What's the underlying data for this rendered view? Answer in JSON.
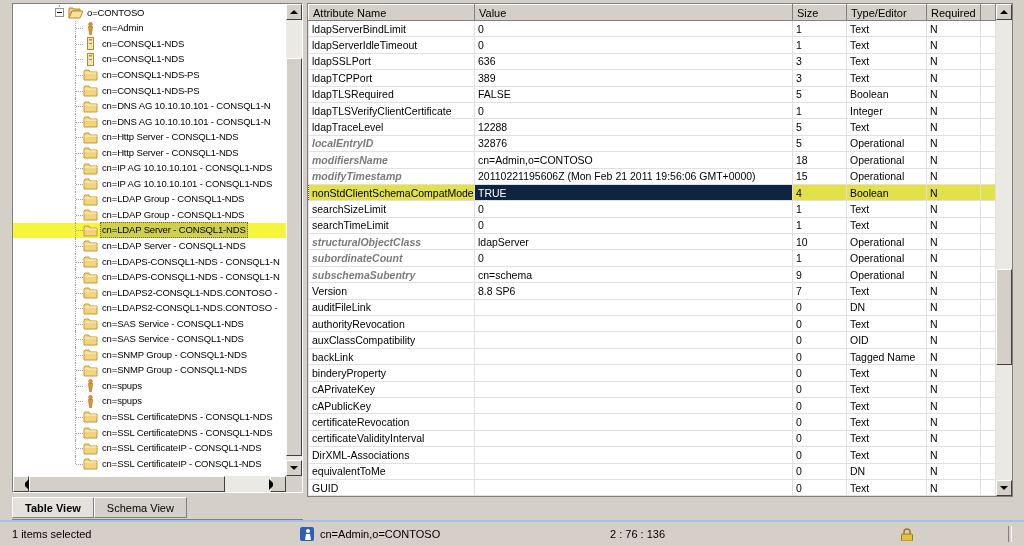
{
  "tree": {
    "root": {
      "label": "o=CONTOSO",
      "expanded": true,
      "selected": false,
      "children": [
        {
          "label": "cn=Admin",
          "kind": "user",
          "selected": false
        },
        {
          "label": "cn=CONSQL1-NDS",
          "kind": "server",
          "selected": false
        },
        {
          "label": "cn=CONSQL1-NDS",
          "kind": "server",
          "selected": false
        },
        {
          "label": "cn=CONSQL1-NDS-PS",
          "kind": "folder",
          "selected": false
        },
        {
          "label": "cn=CONSQL1-NDS-PS",
          "kind": "folder",
          "selected": false
        },
        {
          "label": "cn=DNS AG 10.10.10.101 - CONSQL1-N",
          "kind": "folder",
          "selected": false
        },
        {
          "label": "cn=DNS AG 10.10.10.101 - CONSQL1-N",
          "kind": "folder",
          "selected": false
        },
        {
          "label": "cn=Http Server - CONSQL1-NDS",
          "kind": "folder",
          "selected": false
        },
        {
          "label": "cn=Http Server - CONSQL1-NDS",
          "kind": "folder",
          "selected": false
        },
        {
          "label": "cn=IP AG 10.10.10.101 - CONSQL1-NDS",
          "kind": "folder",
          "selected": false
        },
        {
          "label": "cn=IP AG 10.10.10.101 - CONSQL1-NDS",
          "kind": "folder",
          "selected": false
        },
        {
          "label": "cn=LDAP Group - CONSQL1-NDS",
          "kind": "folder",
          "selected": false
        },
        {
          "label": "cn=LDAP Group - CONSQL1-NDS",
          "kind": "folder",
          "selected": false
        },
        {
          "label": "cn=LDAP Server - CONSQL1-NDS",
          "kind": "folder",
          "selected": true
        },
        {
          "label": "cn=LDAP Server - CONSQL1-NDS",
          "kind": "folder",
          "selected": false
        },
        {
          "label": "cn=LDAPS-CONSQL1-NDS - CONSQL1-N",
          "kind": "folder",
          "selected": false
        },
        {
          "label": "cn=LDAPS-CONSQL1-NDS - CONSQL1-N",
          "kind": "folder",
          "selected": false
        },
        {
          "label": "cn=LDAPS2-CONSQL1-NDS.CONTOSO -",
          "kind": "folder",
          "selected": false
        },
        {
          "label": "cn=LDAPS2-CONSQL1-NDS.CONTOSO -",
          "kind": "folder",
          "selected": false
        },
        {
          "label": "cn=SAS Service - CONSQL1-NDS",
          "kind": "folder",
          "selected": false
        },
        {
          "label": "cn=SAS Service - CONSQL1-NDS",
          "kind": "folder",
          "selected": false
        },
        {
          "label": "cn=SNMP Group - CONSQL1-NDS",
          "kind": "folder",
          "selected": false
        },
        {
          "label": "cn=SNMP Group - CONSQL1-NDS",
          "kind": "folder",
          "selected": false
        },
        {
          "label": "cn=spups",
          "kind": "user",
          "selected": false
        },
        {
          "label": "cn=spups",
          "kind": "user",
          "selected": false
        },
        {
          "label": "cn=SSL CertificateDNS - CONSQL1-NDS",
          "kind": "folder",
          "selected": false
        },
        {
          "label": "cn=SSL CertificateDNS - CONSQL1-NDS",
          "kind": "folder",
          "selected": false
        },
        {
          "label": "cn=SSL CertificateIP - CONSQL1-NDS",
          "kind": "folder",
          "selected": false
        },
        {
          "label": "cn=SSL CertificateIP - CONSQL1-NDS",
          "kind": "folder",
          "selected": false
        }
      ]
    }
  },
  "tabs": [
    {
      "label": "Table View",
      "selected": true
    },
    {
      "label": "Schema View",
      "selected": false
    }
  ],
  "table": {
    "columns": [
      "Attribute Name",
      "Value",
      "Size",
      "Type/Editor",
      "Required"
    ],
    "rows": [
      {
        "cells": [
          "ldapServerBindLimit",
          "0",
          "1",
          "Text",
          "N"
        ],
        "operational": false,
        "selected": false
      },
      {
        "cells": [
          "ldapServerIdleTimeout",
          "0",
          "1",
          "Text",
          "N"
        ],
        "operational": false,
        "selected": false
      },
      {
        "cells": [
          "ldapSSLPort",
          "636",
          "3",
          "Text",
          "N"
        ],
        "operational": false,
        "selected": false
      },
      {
        "cells": [
          "ldapTCPPort",
          "389",
          "3",
          "Text",
          "N"
        ],
        "operational": false,
        "selected": false
      },
      {
        "cells": [
          "ldapTLSRequired",
          "FALSE",
          "5",
          "Boolean",
          "N"
        ],
        "operational": false,
        "selected": false
      },
      {
        "cells": [
          "ldapTLSVerifyClientCertificate",
          "0",
          "1",
          "Integer",
          "N"
        ],
        "operational": false,
        "selected": false
      },
      {
        "cells": [
          "ldapTraceLevel",
          "12288",
          "5",
          "Text",
          "N"
        ],
        "operational": false,
        "selected": false
      },
      {
        "cells": [
          "localEntryID",
          "32876",
          "5",
          "Operational",
          "N"
        ],
        "operational": true,
        "selected": false
      },
      {
        "cells": [
          "modifiersName",
          "cn=Admin,o=CONTOSO",
          "18",
          "Operational",
          "N"
        ],
        "operational": true,
        "selected": false
      },
      {
        "cells": [
          "modifyTimestamp",
          "20110221195606Z (Mon Feb 21 2011 19:56:06 GMT+0000)",
          "15",
          "Operational",
          "N"
        ],
        "operational": true,
        "selected": false
      },
      {
        "cells": [
          "nonStdClientSchemaCompatMode",
          "TRUE",
          "4",
          "Boolean",
          "N"
        ],
        "operational": false,
        "selected": true
      },
      {
        "cells": [
          "searchSizeLimit",
          "0",
          "1",
          "Text",
          "N"
        ],
        "operational": false,
        "selected": false
      },
      {
        "cells": [
          "searchTimeLimit",
          "0",
          "1",
          "Text",
          "N"
        ],
        "operational": false,
        "selected": false
      },
      {
        "cells": [
          "structuralObjectClass",
          "ldapServer",
          "10",
          "Operational",
          "N"
        ],
        "operational": true,
        "selected": false
      },
      {
        "cells": [
          "subordinateCount",
          "0",
          "1",
          "Operational",
          "N"
        ],
        "operational": true,
        "selected": false
      },
      {
        "cells": [
          "subschemaSubentry",
          "cn=schema",
          "9",
          "Operational",
          "N"
        ],
        "operational": true,
        "selected": false
      },
      {
        "cells": [
          "Version",
          "8.8 SP6",
          "7",
          "Text",
          "N"
        ],
        "operational": false,
        "selected": false
      },
      {
        "cells": [
          "auditFileLink",
          "",
          "0",
          "DN",
          "N"
        ],
        "operational": false,
        "selected": false
      },
      {
        "cells": [
          "authorityRevocation",
          "",
          "0",
          "Text",
          "N"
        ],
        "operational": false,
        "selected": false
      },
      {
        "cells": [
          "auxClassCompatibility",
          "",
          "0",
          "OID",
          "N"
        ],
        "operational": false,
        "selected": false
      },
      {
        "cells": [
          "backLink",
          "",
          "0",
          "Tagged Name",
          "N"
        ],
        "operational": false,
        "selected": false
      },
      {
        "cells": [
          "binderyProperty",
          "",
          "0",
          "Text",
          "N"
        ],
        "operational": false,
        "selected": false
      },
      {
        "cells": [
          "cAPrivateKey",
          "",
          "0",
          "Text",
          "N"
        ],
        "operational": false,
        "selected": false
      },
      {
        "cells": [
          "cAPublicKey",
          "",
          "0",
          "Text",
          "N"
        ],
        "operational": false,
        "selected": false
      },
      {
        "cells": [
          "certificateRevocation",
          "",
          "0",
          "Text",
          "N"
        ],
        "operational": false,
        "selected": false
      },
      {
        "cells": [
          "certificateValidityInterval",
          "",
          "0",
          "Text",
          "N"
        ],
        "operational": false,
        "selected": false
      },
      {
        "cells": [
          "DirXML-Associations",
          "",
          "0",
          "Text",
          "N"
        ],
        "operational": false,
        "selected": false
      },
      {
        "cells": [
          "equivalentToMe",
          "",
          "0",
          "DN",
          "N"
        ],
        "operational": false,
        "selected": false
      },
      {
        "cells": [
          "GUID",
          "",
          "0",
          "Text",
          "N"
        ],
        "operational": false,
        "selected": false
      }
    ]
  },
  "status_bar": {
    "selection": "1 items selected",
    "user": "cn=Admin,o=CONTOSO",
    "position": "2 : 76 : 136"
  }
}
